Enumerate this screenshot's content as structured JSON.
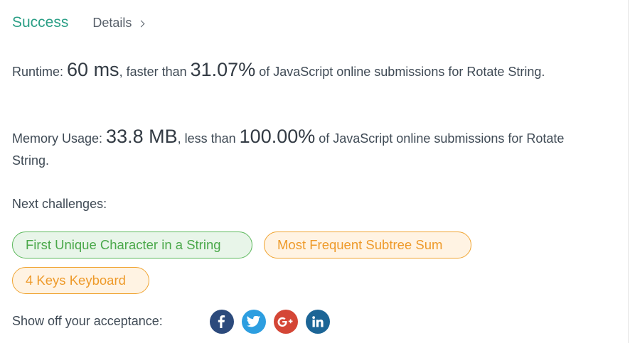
{
  "header": {
    "status": "Success",
    "details_label": "Details"
  },
  "runtime": {
    "label": "Runtime: ",
    "value": "60 ms",
    "comparison": ", faster than ",
    "percent": "31.07%",
    "suffix": " of JavaScript online submissions for Rotate String."
  },
  "memory": {
    "label": "Memory Usage: ",
    "value": "33.8 MB",
    "comparison": ", less than ",
    "percent": "100.00%",
    "suffix": " of JavaScript online submissions for Rotate String."
  },
  "next": {
    "label": "Next challenges:",
    "challenges": [
      {
        "title": "First Unique Character in a String",
        "difficulty_color": "#5cb85c"
      },
      {
        "title": "Most Frequent Subtree Sum",
        "difficulty_color": "#f0a431"
      },
      {
        "title": "4 Keys Keyboard",
        "difficulty_color": "#f0a431"
      }
    ]
  },
  "share": {
    "label": "Show off your acceptance:",
    "icons": [
      "facebook-icon",
      "twitter-icon",
      "google-plus-icon",
      "linkedin-icon"
    ]
  },
  "colors": {
    "success": "#2b9f86",
    "facebook": "#2c4a7c",
    "twitter": "#2d9ee0",
    "google_plus": "#d44636",
    "linkedin": "#1c6596"
  }
}
